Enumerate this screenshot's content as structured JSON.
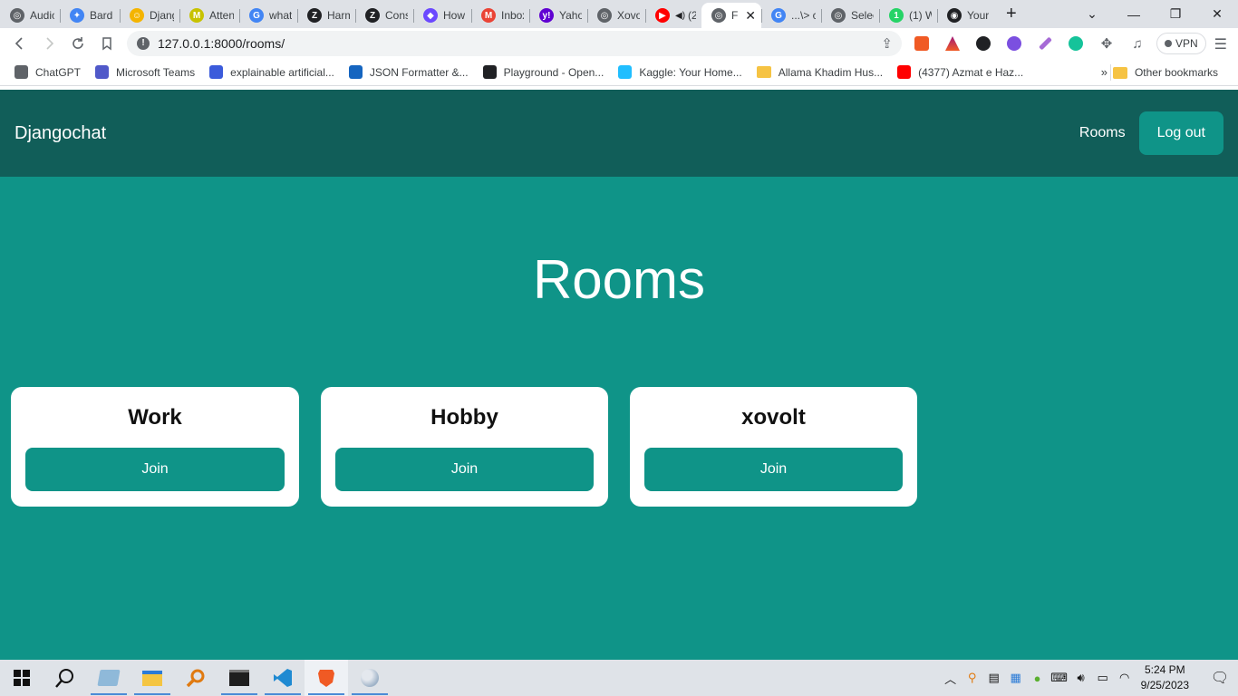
{
  "browser": {
    "tabs": [
      {
        "label": "Audic",
        "color": "#5f6368",
        "glyph": "◎"
      },
      {
        "label": "Bard",
        "color": "#4285f4",
        "glyph": "✦"
      },
      {
        "label": "Djang",
        "color": "#f4b400",
        "glyph": "☺"
      },
      {
        "label": "Atten",
        "color": "#c7c200",
        "glyph": "M"
      },
      {
        "label": "what",
        "color": "#4285f4",
        "glyph": "G"
      },
      {
        "label": "Harm",
        "color": "#202124",
        "glyph": "Z"
      },
      {
        "label": "Cons",
        "color": "#202124",
        "glyph": "Z"
      },
      {
        "label": "How",
        "color": "#6b48ff",
        "glyph": "◆"
      },
      {
        "label": "Inbox",
        "color": "#ea4335",
        "glyph": "M"
      },
      {
        "label": "Yaho",
        "color": "#6001d2",
        "glyph": "y!"
      },
      {
        "label": "Xovo",
        "color": "#5f6368",
        "glyph": "◎"
      },
      {
        "label": "(2",
        "color": "#ff0000",
        "glyph": "▶"
      },
      {
        "label": "F",
        "color": "#5f6368",
        "glyph": "◎"
      },
      {
        "label": "...\\> c",
        "color": "#4285f4",
        "glyph": "G"
      },
      {
        "label": "Selec",
        "color": "#5f6368",
        "glyph": "◎"
      },
      {
        "label": "(1) W",
        "color": "#25d366",
        "glyph": "1"
      },
      {
        "label": "Your",
        "color": "#202124",
        "glyph": "◉"
      }
    ],
    "url": "127.0.0.1:8000/rooms/",
    "vpn_label": "VPN",
    "bookmarks": [
      {
        "label": "ChatGPT",
        "color": "#5f6368"
      },
      {
        "label": "Microsoft Teams",
        "color": "#5059c9"
      },
      {
        "label": "explainable artificial...",
        "color": "#3b5bdb"
      },
      {
        "label": "JSON Formatter &...",
        "color": "#1565c0"
      },
      {
        "label": "Playground - Open...",
        "color": "#202124"
      },
      {
        "label": "Kaggle: Your Home...",
        "color": "#20beff"
      },
      {
        "label": "Allama Khadim Hus...",
        "color": "#f6c343"
      },
      {
        "label": "(4377) Azmat e Haz...",
        "color": "#ff0000"
      }
    ],
    "other_bookmarks": "Other bookmarks"
  },
  "app": {
    "brand": "Djangochat",
    "nav_rooms": "Rooms",
    "nav_logout": "Log out",
    "page_title": "Rooms",
    "rooms": [
      {
        "name": "Work",
        "button": "Join"
      },
      {
        "name": "Hobby",
        "button": "Join"
      },
      {
        "name": "xovolt",
        "button": "Join"
      }
    ],
    "colors": {
      "nav_bg": "#115e59",
      "page_bg": "#0f9488",
      "button_bg": "#0f9488"
    }
  },
  "taskbar": {
    "time": "5:24 PM",
    "date": "9/25/2023"
  }
}
